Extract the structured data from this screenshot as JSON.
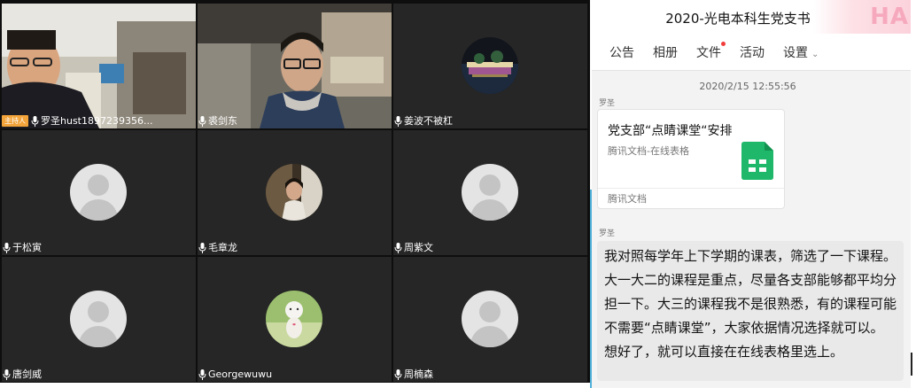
{
  "video": {
    "host_badge": "主持人",
    "participants": [
      {
        "name": "罗圣hust1897239356...",
        "type": "camera",
        "host": true
      },
      {
        "name": "裘剑东",
        "type": "camera"
      },
      {
        "name": "姜波不被杠",
        "type": "photo"
      },
      {
        "name": "于松寅",
        "type": "default-avatar"
      },
      {
        "name": "毛章龙",
        "type": "photo"
      },
      {
        "name": "周紫文",
        "type": "default-avatar"
      },
      {
        "name": "唐剑威",
        "type": "default-avatar"
      },
      {
        "name": "Georgewuwu",
        "type": "photo"
      },
      {
        "name": "周楠森",
        "type": "default-avatar"
      }
    ]
  },
  "chat": {
    "title": "2020-光电本科生党支书",
    "header_decoration": "HA",
    "tabs": [
      {
        "label": "公告"
      },
      {
        "label": "相册"
      },
      {
        "label": "文件",
        "has_dot": true
      },
      {
        "label": "活动"
      },
      {
        "label": "设置",
        "has_dropdown": true
      }
    ],
    "timestamp": "2020/2/15 12:55:56",
    "messages": [
      {
        "sender": "罗圣",
        "card": {
          "title": "党支部“点睛课堂“安排",
          "subtitle": "腾讯文档-在线表格",
          "footer": "腾讯文档",
          "icon": "sheet-icon"
        }
      },
      {
        "sender": "罗圣",
        "text": "我对照每学年上下学期的课表，筛选了一下课程。大一大二的课程是重点，尽量各支部能够都平均分担一下。大三的课程我不是很熟悉，有的课程可能不需要“点睛课堂”，大家依据情况选择就可以。想好了，就可以直接在在线表格里选上。"
      }
    ]
  },
  "colors": {
    "host_badge": "#f3a43b",
    "sheet_green": "#1fb86a",
    "accent_blue": "#4fb1d9",
    "notification_dot": "#f23c3c"
  }
}
